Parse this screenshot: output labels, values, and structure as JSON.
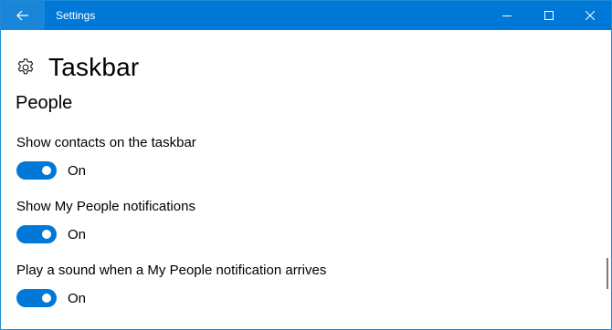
{
  "window": {
    "title": "Settings",
    "accent_color": "#0078d7",
    "controls": {
      "back_icon": "back-arrow-icon",
      "minimize_icon": "minimize-icon",
      "maximize_icon": "maximize-icon",
      "close_icon": "close-icon"
    }
  },
  "page": {
    "title": "Taskbar",
    "icon": "gear-icon",
    "section": "People"
  },
  "settings": [
    {
      "label": "Show contacts on the taskbar",
      "state": "On",
      "enabled": true
    },
    {
      "label": "Show My People notifications",
      "state": "On",
      "enabled": true
    },
    {
      "label": "Play a sound when a My People notification arrives",
      "state": "On",
      "enabled": true
    }
  ]
}
